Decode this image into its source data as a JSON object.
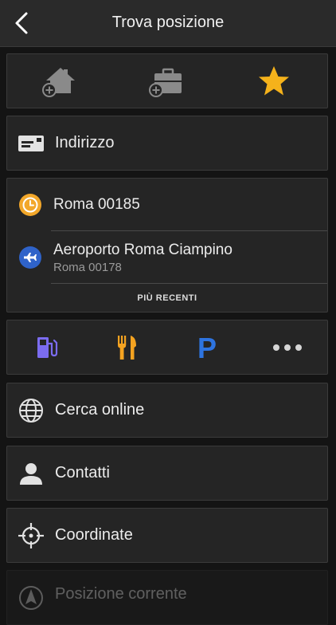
{
  "header": {
    "title": "Trova posizione",
    "back_icon": "chevron-left-icon"
  },
  "shortcuts": {
    "home_icon": "home-add-icon",
    "work_icon": "briefcase-add-icon",
    "favorites_icon": "star-icon",
    "favorites_color": "#f5b21b"
  },
  "address": {
    "label": "Indirizzo",
    "icon": "envelope-icon"
  },
  "recents": {
    "items": [
      {
        "title": "Roma 00185",
        "subtitle": "",
        "icon": "clock-icon",
        "icon_color": "#f2a72a"
      },
      {
        "title": "Aeroporto Roma Ciampino",
        "subtitle": "Roma 00178",
        "icon": "airplane-icon",
        "icon_color": "#2f63c9"
      }
    ],
    "more_label": "PIÙ RECENTI"
  },
  "categories": {
    "fuel_icon": "fuel-pump-icon",
    "food_icon": "restaurant-icon",
    "parking_icon": "parking-icon",
    "more_icon": "more-dots-icon",
    "parking_letter": "P",
    "colors": {
      "fuel": "#7b6cf0",
      "food": "#f5a320",
      "parking": "#2e74e0"
    }
  },
  "menu": {
    "online": {
      "label": "Cerca online",
      "icon": "globe-icon"
    },
    "contacts": {
      "label": "Contatti",
      "icon": "person-icon"
    },
    "coordinates": {
      "label": "Coordinate",
      "icon": "crosshair-icon"
    },
    "current": {
      "label": "Posizione corrente",
      "icon": "navigation-arrow-icon"
    }
  }
}
